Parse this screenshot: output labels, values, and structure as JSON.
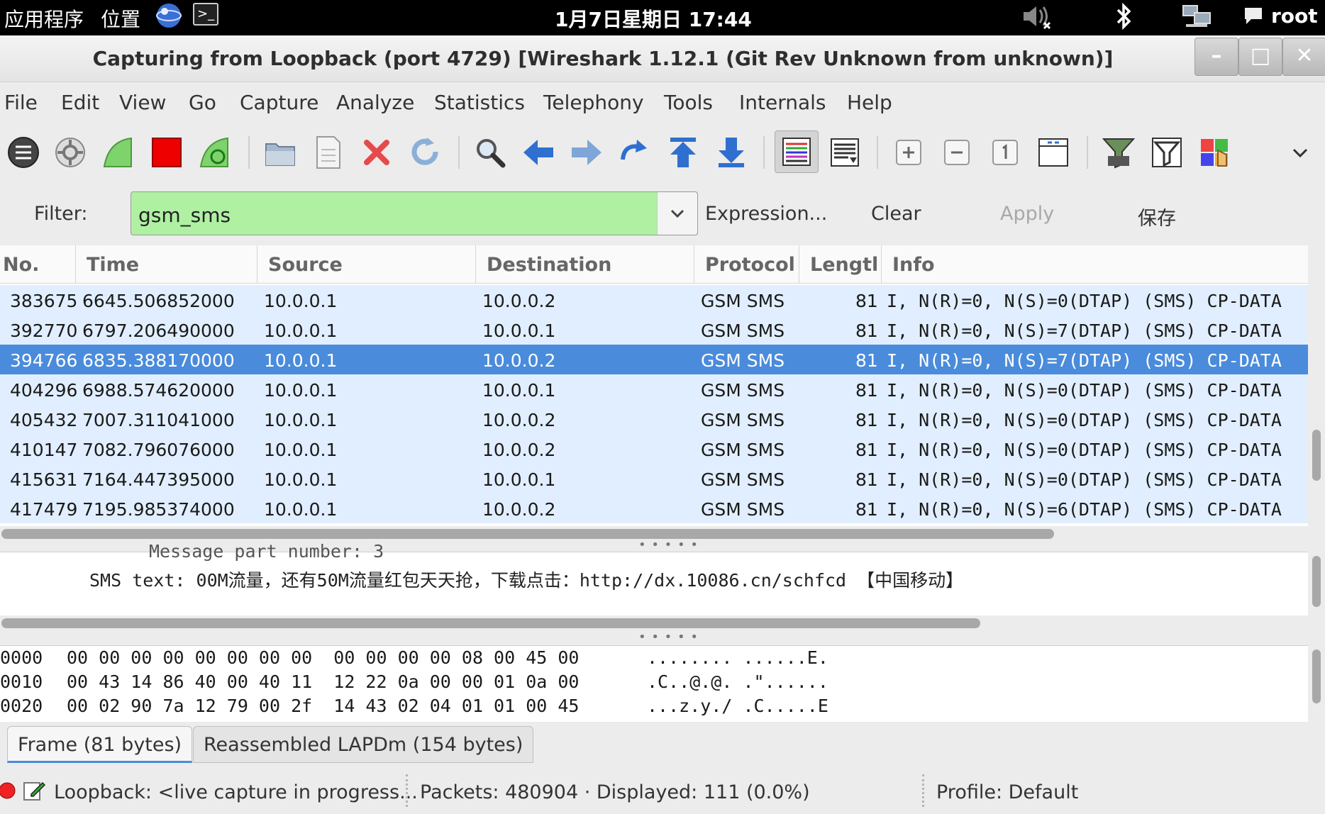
{
  "topbar": {
    "apps": "应用程序",
    "places": "位置",
    "terminal_glyph": ">_",
    "clock": "1月7日星期日 17:44",
    "user": "root"
  },
  "window": {
    "title": "Capturing from Loopback (port 4729)    [Wireshark 1.12.1  (Git Rev Unknown from unknown)]",
    "minimize": "–",
    "maximize": "□",
    "close": "✕"
  },
  "menu": [
    "File",
    "Edit",
    "View",
    "Go",
    "Capture",
    "Analyze",
    "Statistics",
    "Telephony",
    "Tools",
    "Internals",
    "Help"
  ],
  "filter": {
    "label": "Filter:",
    "value": "gsm_sms",
    "expression": "Expression...",
    "clear": "Clear",
    "apply": "Apply",
    "save": "保存"
  },
  "packet_list": {
    "columns": [
      "No.",
      "Time",
      "Source",
      "Destination",
      "Protocol",
      "Lengtl",
      "Info"
    ],
    "rows": [
      {
        "no": "383675",
        "time": "6645.506852000",
        "src": "10.0.0.1",
        "dst": "10.0.0.2",
        "proto": "GSM SMS",
        "len": "81",
        "info": "I, N(R)=0, N(S)=0(DTAP) (SMS) CP-DATA"
      },
      {
        "no": "392770",
        "time": "6797.206490000",
        "src": "10.0.0.1",
        "dst": "10.0.0.1",
        "proto": "GSM SMS",
        "len": "81",
        "info": "I, N(R)=0, N(S)=7(DTAP) (SMS) CP-DATA"
      },
      {
        "no": "394766",
        "time": "6835.388170000",
        "src": "10.0.0.1",
        "dst": "10.0.0.2",
        "proto": "GSM SMS",
        "len": "81",
        "info": "I, N(R)=0, N(S)=7(DTAP) (SMS) CP-DATA"
      },
      {
        "no": "404296",
        "time": "6988.574620000",
        "src": "10.0.0.1",
        "dst": "10.0.0.1",
        "proto": "GSM SMS",
        "len": "81",
        "info": "I, N(R)=0, N(S)=0(DTAP) (SMS) CP-DATA"
      },
      {
        "no": "405432",
        "time": "7007.311041000",
        "src": "10.0.0.1",
        "dst": "10.0.0.2",
        "proto": "GSM SMS",
        "len": "81",
        "info": "I, N(R)=0, N(S)=0(DTAP) (SMS) CP-DATA"
      },
      {
        "no": "410147",
        "time": "7082.796076000",
        "src": "10.0.0.1",
        "dst": "10.0.0.2",
        "proto": "GSM SMS",
        "len": "81",
        "info": "I, N(R)=0, N(S)=0(DTAP) (SMS) CP-DATA"
      },
      {
        "no": "415631",
        "time": "7164.447395000",
        "src": "10.0.0.1",
        "dst": "10.0.0.1",
        "proto": "GSM SMS",
        "len": "81",
        "info": "I, N(R)=0, N(S)=0(DTAP) (SMS) CP-DATA"
      },
      {
        "no": "417479",
        "time": "7195.985374000",
        "src": "10.0.0.1",
        "dst": "10.0.0.2",
        "proto": "GSM SMS",
        "len": "81",
        "info": "I, N(R)=0, N(S)=6(DTAP) (SMS) CP-DATA"
      }
    ],
    "selected_index": 2
  },
  "detail": {
    "cut_line": "Message part number: 3",
    "sms_text": "SMS text: 00M流量，还有50M流量红包天天抢，下载点击：http://dx.10086.cn/schfcd 【中国移动】"
  },
  "hex": [
    {
      "offset": "0000",
      "bytes": "00 00 00 00 00 00 00 00  00 00 00 00 08 00 45 00",
      "ascii": "........ ......E."
    },
    {
      "offset": "0010",
      "bytes": "00 43 14 86 40 00 40 11  12 22 0a 00 00 01 0a 00",
      "ascii": ".C..@.@. .\"......"
    },
    {
      "offset": "0020",
      "bytes": "00 02 90 7a 12 79 00 2f  14 43 02 04 01 01 00 45",
      "ascii": "...z.y./ .C.....E"
    }
  ],
  "tabs": [
    "Frame (81 bytes)",
    "Reassembled LAPDm (154 bytes)"
  ],
  "status": {
    "capture": "Loopback: <live capture in progress...",
    "packets": "Packets: 480904 · Displayed: 111 (0.0%)",
    "profile": "Profile: Default"
  },
  "colors": {
    "row_bg": "#e1eeff",
    "selected_bg": "#4a8bdb",
    "filter_valid_bg": "#aff0a3"
  }
}
